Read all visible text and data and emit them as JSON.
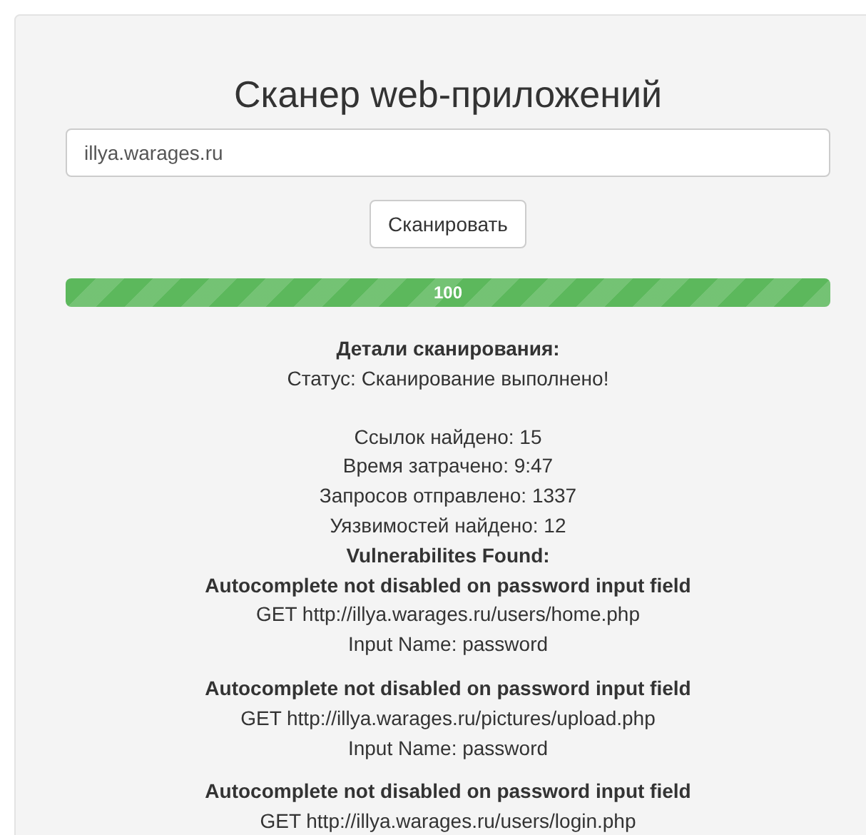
{
  "title": "Сканер web-приложений",
  "url_input": {
    "value": "illya.warages.ru"
  },
  "scan_button": "Сканировать",
  "progress": {
    "level": 1,
    "label": "100"
  },
  "details": {
    "heading": "Детали сканирования:",
    "status": "Статус: Сканирование выполнено!",
    "stats": [
      "Ссылок найдено: 15",
      "Время затрачено: 9:47",
      "Запросов отправлено: 1337",
      "Уязвимостей найдено: 12"
    ],
    "vulns_heading": "Vulnerabilites Found:",
    "vulnerabilities": [
      {
        "title": "Autocomplete not disabled on password input field",
        "request": "GET http://illya.warages.ru/users/home.php",
        "input_name": "Input Name: password"
      },
      {
        "title": "Autocomplete not disabled on password input field",
        "request": "GET http://illya.warages.ru/pictures/upload.php",
        "input_name": "Input Name: password"
      },
      {
        "title": "Autocomplete not disabled on password input field",
        "request": "GET http://illya.warages.ru/users/login.php"
      }
    ]
  }
}
